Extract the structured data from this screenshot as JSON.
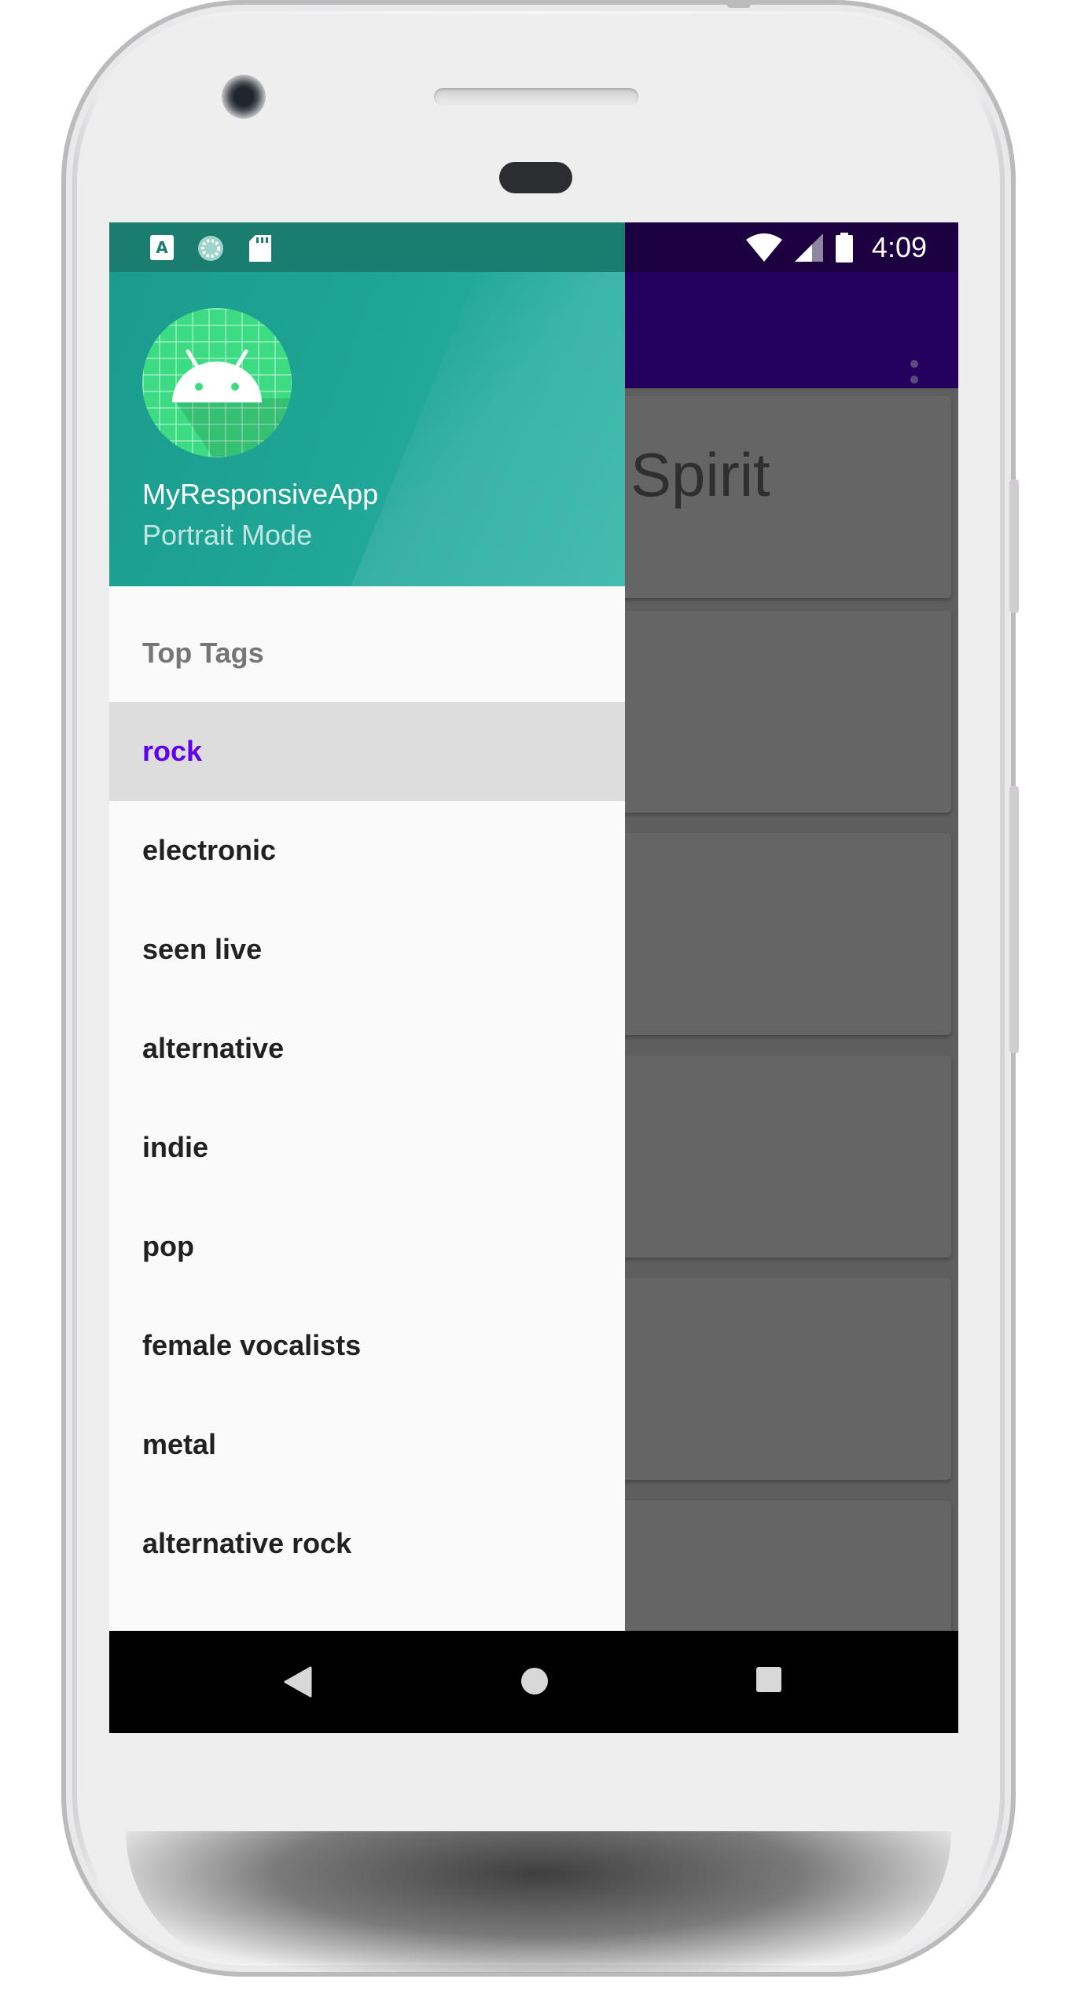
{
  "status_bar": {
    "time": "4:09",
    "left_icons": [
      "a-notification-icon",
      "sync-icon",
      "sd-card-icon"
    ],
    "right_icons": [
      "wifi-icon",
      "cell-signal-icon",
      "battery-icon"
    ]
  },
  "drawer": {
    "header": {
      "app_name": "MyResponsiveApp",
      "subtitle": "Portrait Mode",
      "avatar_icon": "android-icon"
    },
    "section_title": "Top Tags",
    "items": [
      {
        "label": "rock",
        "selected": true
      },
      {
        "label": "electronic"
      },
      {
        "label": "seen live"
      },
      {
        "label": "alternative"
      },
      {
        "label": "indie"
      },
      {
        "label": "pop"
      },
      {
        "label": "female vocalists"
      },
      {
        "label": "metal"
      },
      {
        "label": "alternative rock"
      }
    ]
  },
  "background": {
    "first_card_title": "Spirit",
    "card_count": 6
  },
  "nav_bar": {
    "buttons": [
      "back-icon",
      "home-icon",
      "recents-icon"
    ]
  },
  "colors": {
    "drawer_header": "#1fa595",
    "toolbar": "#24005f",
    "selected_item_text": "#6200ee",
    "selected_item_bg": "#dddddd"
  }
}
